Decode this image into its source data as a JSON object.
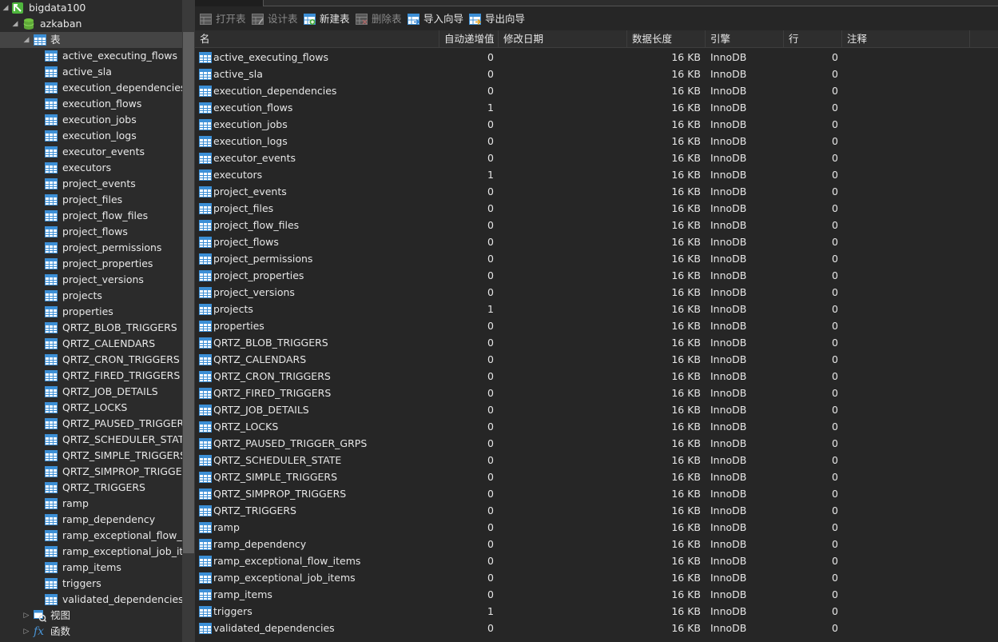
{
  "sidebar": {
    "connection": "bigdata100",
    "database": "azkaban",
    "tables_group": "表",
    "views_group": "视图",
    "functions_group": "函数",
    "tables": [
      "active_executing_flows",
      "active_sla",
      "execution_dependencies",
      "execution_flows",
      "execution_jobs",
      "execution_logs",
      "executor_events",
      "executors",
      "project_events",
      "project_files",
      "project_flow_files",
      "project_flows",
      "project_permissions",
      "project_properties",
      "project_versions",
      "projects",
      "properties",
      "QRTZ_BLOB_TRIGGERS",
      "QRTZ_CALENDARS",
      "QRTZ_CRON_TRIGGERS",
      "QRTZ_FIRED_TRIGGERS",
      "QRTZ_JOB_DETAILS",
      "QRTZ_LOCKS",
      "QRTZ_PAUSED_TRIGGER_G",
      "QRTZ_SCHEDULER_STATE",
      "QRTZ_SIMPLE_TRIGGERS",
      "QRTZ_SIMPROP_TRIGGER",
      "QRTZ_TRIGGERS",
      "ramp",
      "ramp_dependency",
      "ramp_exceptional_flow_ite",
      "ramp_exceptional_job_iter",
      "ramp_items",
      "triggers",
      "validated_dependencies"
    ]
  },
  "toolbar": {
    "open": "打开表",
    "design": "设计表",
    "new": "新建表",
    "delete": "删除表",
    "import": "导入向导",
    "export": "导出向导"
  },
  "columns": {
    "name": "名",
    "auto_inc": "自动递增值",
    "modified": "修改日期",
    "data_length": "数据长度",
    "engine": "引擎",
    "rows": "行",
    "comment": "注释"
  },
  "rows": [
    {
      "name": "active_executing_flows",
      "auto_inc": "0",
      "size": "16 KB",
      "engine": "InnoDB",
      "rows": "0"
    },
    {
      "name": "active_sla",
      "auto_inc": "0",
      "size": "16 KB",
      "engine": "InnoDB",
      "rows": "0"
    },
    {
      "name": "execution_dependencies",
      "auto_inc": "0",
      "size": "16 KB",
      "engine": "InnoDB",
      "rows": "0"
    },
    {
      "name": "execution_flows",
      "auto_inc": "1",
      "size": "16 KB",
      "engine": "InnoDB",
      "rows": "0"
    },
    {
      "name": "execution_jobs",
      "auto_inc": "0",
      "size": "16 KB",
      "engine": "InnoDB",
      "rows": "0"
    },
    {
      "name": "execution_logs",
      "auto_inc": "0",
      "size": "16 KB",
      "engine": "InnoDB",
      "rows": "0"
    },
    {
      "name": "executor_events",
      "auto_inc": "0",
      "size": "16 KB",
      "engine": "InnoDB",
      "rows": "0"
    },
    {
      "name": "executors",
      "auto_inc": "1",
      "size": "16 KB",
      "engine": "InnoDB",
      "rows": "0"
    },
    {
      "name": "project_events",
      "auto_inc": "0",
      "size": "16 KB",
      "engine": "InnoDB",
      "rows": "0"
    },
    {
      "name": "project_files",
      "auto_inc": "0",
      "size": "16 KB",
      "engine": "InnoDB",
      "rows": "0"
    },
    {
      "name": "project_flow_files",
      "auto_inc": "0",
      "size": "16 KB",
      "engine": "InnoDB",
      "rows": "0"
    },
    {
      "name": "project_flows",
      "auto_inc": "0",
      "size": "16 KB",
      "engine": "InnoDB",
      "rows": "0"
    },
    {
      "name": "project_permissions",
      "auto_inc": "0",
      "size": "16 KB",
      "engine": "InnoDB",
      "rows": "0"
    },
    {
      "name": "project_properties",
      "auto_inc": "0",
      "size": "16 KB",
      "engine": "InnoDB",
      "rows": "0"
    },
    {
      "name": "project_versions",
      "auto_inc": "0",
      "size": "16 KB",
      "engine": "InnoDB",
      "rows": "0"
    },
    {
      "name": "projects",
      "auto_inc": "1",
      "size": "16 KB",
      "engine": "InnoDB",
      "rows": "0"
    },
    {
      "name": "properties",
      "auto_inc": "0",
      "size": "16 KB",
      "engine": "InnoDB",
      "rows": "0"
    },
    {
      "name": "QRTZ_BLOB_TRIGGERS",
      "auto_inc": "0",
      "size": "16 KB",
      "engine": "InnoDB",
      "rows": "0"
    },
    {
      "name": "QRTZ_CALENDARS",
      "auto_inc": "0",
      "size": "16 KB",
      "engine": "InnoDB",
      "rows": "0"
    },
    {
      "name": "QRTZ_CRON_TRIGGERS",
      "auto_inc": "0",
      "size": "16 KB",
      "engine": "InnoDB",
      "rows": "0"
    },
    {
      "name": "QRTZ_FIRED_TRIGGERS",
      "auto_inc": "0",
      "size": "16 KB",
      "engine": "InnoDB",
      "rows": "0"
    },
    {
      "name": "QRTZ_JOB_DETAILS",
      "auto_inc": "0",
      "size": "16 KB",
      "engine": "InnoDB",
      "rows": "0"
    },
    {
      "name": "QRTZ_LOCKS",
      "auto_inc": "0",
      "size": "16 KB",
      "engine": "InnoDB",
      "rows": "0"
    },
    {
      "name": "QRTZ_PAUSED_TRIGGER_GRPS",
      "auto_inc": "0",
      "size": "16 KB",
      "engine": "InnoDB",
      "rows": "0"
    },
    {
      "name": "QRTZ_SCHEDULER_STATE",
      "auto_inc": "0",
      "size": "16 KB",
      "engine": "InnoDB",
      "rows": "0"
    },
    {
      "name": "QRTZ_SIMPLE_TRIGGERS",
      "auto_inc": "0",
      "size": "16 KB",
      "engine": "InnoDB",
      "rows": "0"
    },
    {
      "name": "QRTZ_SIMPROP_TRIGGERS",
      "auto_inc": "0",
      "size": "16 KB",
      "engine": "InnoDB",
      "rows": "0"
    },
    {
      "name": "QRTZ_TRIGGERS",
      "auto_inc": "0",
      "size": "16 KB",
      "engine": "InnoDB",
      "rows": "0"
    },
    {
      "name": "ramp",
      "auto_inc": "0",
      "size": "16 KB",
      "engine": "InnoDB",
      "rows": "0"
    },
    {
      "name": "ramp_dependency",
      "auto_inc": "0",
      "size": "16 KB",
      "engine": "InnoDB",
      "rows": "0"
    },
    {
      "name": "ramp_exceptional_flow_items",
      "auto_inc": "0",
      "size": "16 KB",
      "engine": "InnoDB",
      "rows": "0"
    },
    {
      "name": "ramp_exceptional_job_items",
      "auto_inc": "0",
      "size": "16 KB",
      "engine": "InnoDB",
      "rows": "0"
    },
    {
      "name": "ramp_items",
      "auto_inc": "0",
      "size": "16 KB",
      "engine": "InnoDB",
      "rows": "0"
    },
    {
      "name": "triggers",
      "auto_inc": "1",
      "size": "16 KB",
      "engine": "InnoDB",
      "rows": "0"
    },
    {
      "name": "validated_dependencies",
      "auto_inc": "0",
      "size": "16 KB",
      "engine": "InnoDB",
      "rows": "0"
    }
  ],
  "colors": {
    "table_icon_blue": "#3c8fd6",
    "db_icon_green": "#5ea838",
    "conn_icon_green": "#4fb63e"
  }
}
